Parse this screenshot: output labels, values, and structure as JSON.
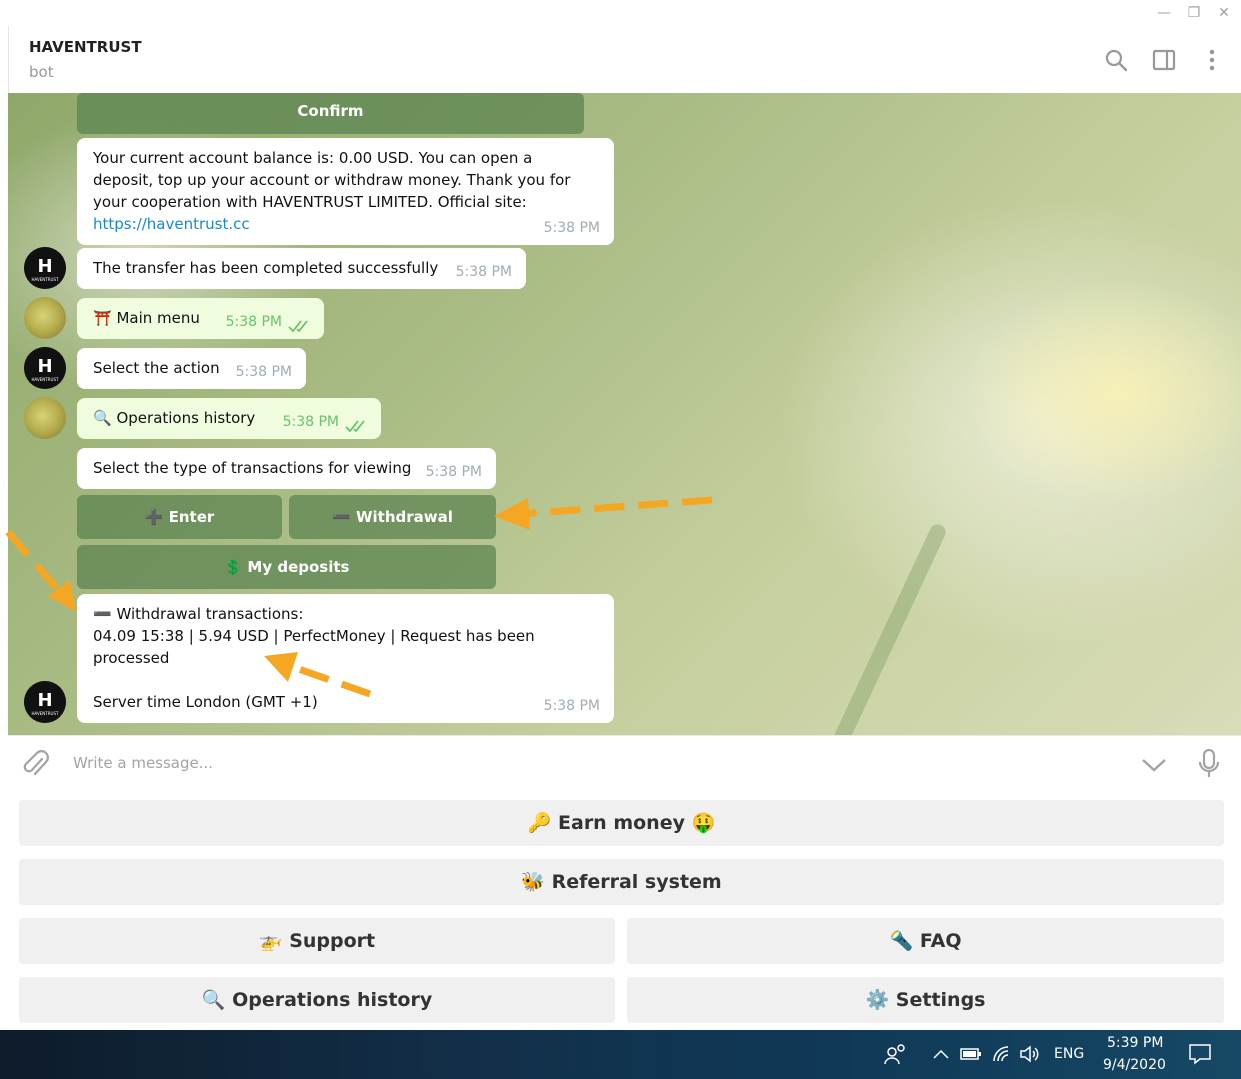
{
  "window": {
    "minimize": "—",
    "restore": "❐",
    "close": "✕"
  },
  "header": {
    "title": "HAVENTRUST",
    "subtitle": "bot"
  },
  "messages": {
    "confirm_button": "Confirm",
    "balance": {
      "text": "Your current account balance is: 0.00 USD. You can open a deposit, top up your account or withdraw money. Thank you for your cooperation with HAVENTRUST LIMITED. Official site: ",
      "link": "https://haventrust.cc",
      "time": "5:38 PM"
    },
    "transfer": {
      "text": "The transfer has been completed successfully",
      "time": "5:38 PM"
    },
    "main_menu": {
      "icon": "⛩️",
      "text": "Main menu",
      "time": "5:38 PM"
    },
    "select_action": {
      "text": "Select the action",
      "time": "5:38 PM"
    },
    "ops_history": {
      "icon": "🔍",
      "text": "Operations history",
      "time": "5:38 PM"
    },
    "select_type": {
      "text": "Select the type of transactions for viewing",
      "time": "5:38 PM"
    },
    "inline_buttons": {
      "enter": {
        "icon": "➕",
        "label": "Enter"
      },
      "withdrawal": {
        "icon": "➖",
        "label": "Withdrawal"
      },
      "deposits": {
        "icon": "💲",
        "label": "My deposits"
      }
    },
    "withdrawals": {
      "header_icon": "➖",
      "header": "Withdrawal transactions:",
      "line1": "04.09 15:38 | 5.94 USD | PerfectMoney | Request has been",
      "line2": "processed",
      "server_time": "Server time London (GMT +1)",
      "time": "5:38 PM"
    }
  },
  "bot_avatar": {
    "letter": "H",
    "caption": "HAVENTRUST"
  },
  "composer": {
    "placeholder": "Write a message..."
  },
  "keyboard": {
    "earn": {
      "icon": "🔑",
      "label": "Earn money",
      "emoji": "🤑"
    },
    "referral": {
      "icon": "🐝",
      "label": "Referral system"
    },
    "support": {
      "icon": "🚁",
      "label": "Support"
    },
    "faq": {
      "icon": "🔦",
      "label": "FAQ"
    },
    "operations": {
      "icon": "🔍",
      "label": "Operations history"
    },
    "settings": {
      "icon": "⚙️",
      "label": "Settings"
    }
  },
  "taskbar": {
    "language": "ENG",
    "time": "5:39 PM",
    "date": "9/4/2020"
  },
  "colors": {
    "accent_link": "#168acd",
    "outgoing_bubble": "#effdde",
    "inline_button": "#5c8452",
    "annotation_arrow": "#f5a623"
  }
}
